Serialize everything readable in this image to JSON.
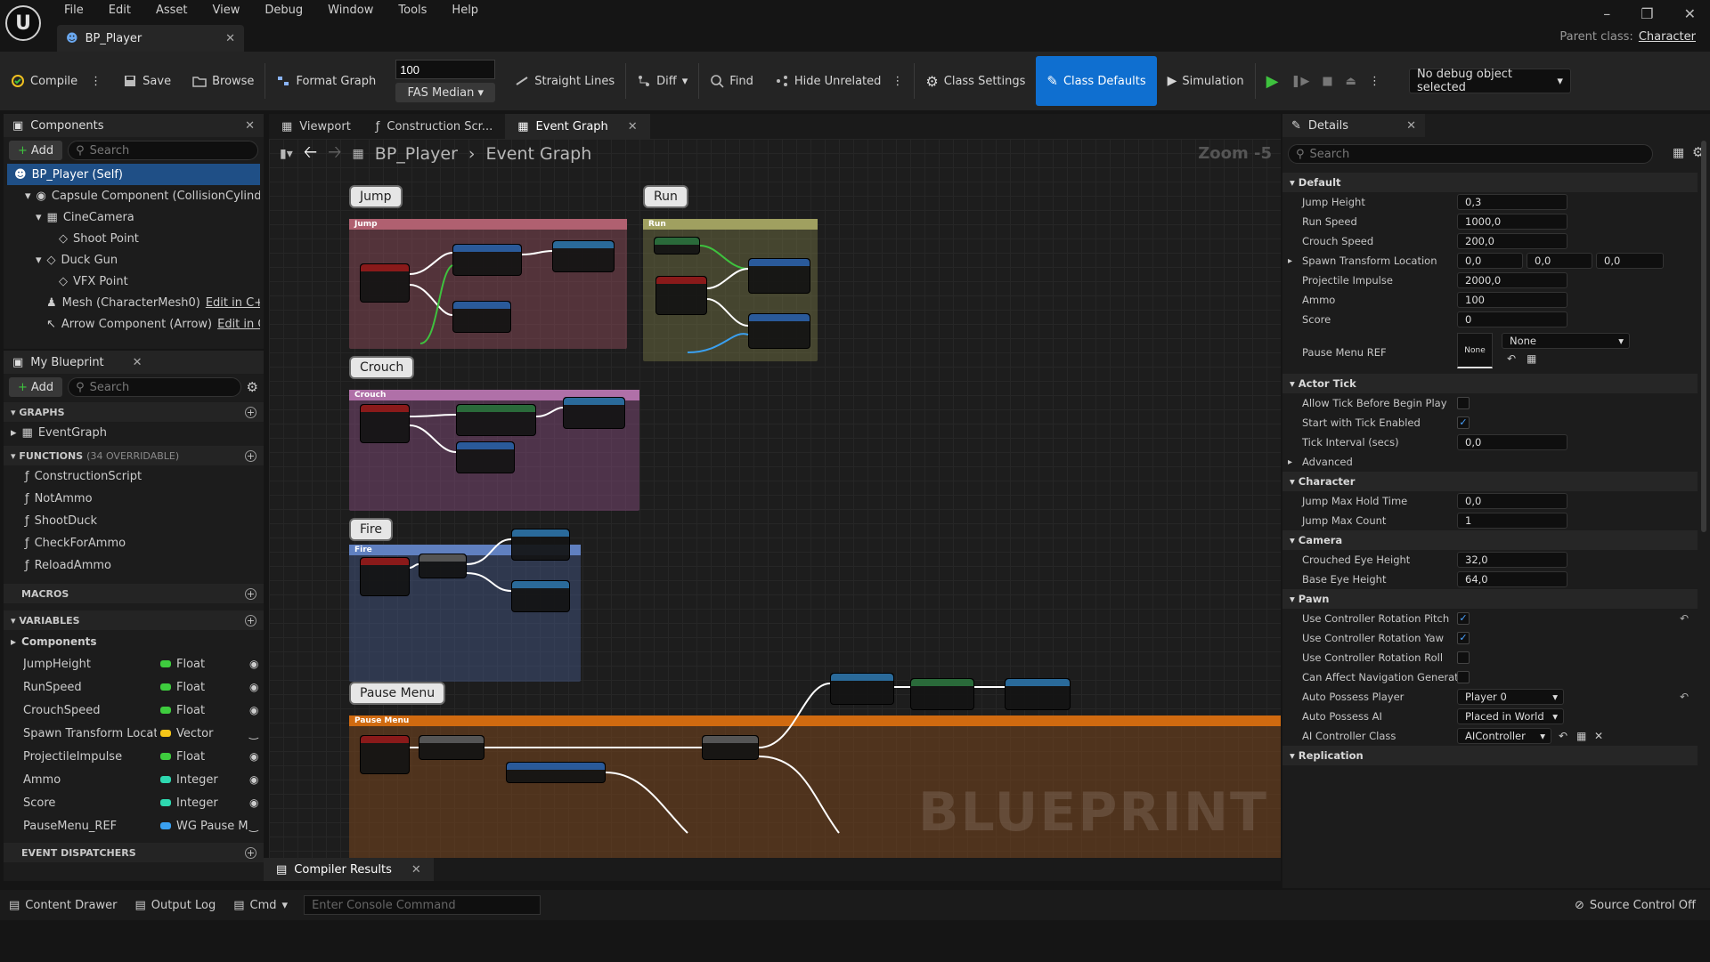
{
  "menu": [
    "File",
    "Edit",
    "Asset",
    "View",
    "Debug",
    "Window",
    "Tools",
    "Help"
  ],
  "asset_tab": {
    "label": "BP_Player"
  },
  "parent_class": {
    "label": "Parent class:",
    "value": "Character"
  },
  "toolbar": {
    "compile": "Compile",
    "save": "Save",
    "browse": "Browse",
    "format_graph": "Format Graph",
    "zoom_value": "100",
    "fas_median": "FAS Median",
    "straight_lines": "Straight Lines",
    "diff": "Diff",
    "find": "Find",
    "hide_unrelated": "Hide Unrelated",
    "class_settings": "Class Settings",
    "class_defaults": "Class Defaults",
    "simulation": "Simulation",
    "debug_object": "No debug object selected"
  },
  "components": {
    "title": "Components",
    "add": "Add",
    "search_placeholder": "Search",
    "items": [
      {
        "label": "BP_Player (Self)"
      },
      {
        "label": "Capsule Component (CollisionCylinde"
      },
      {
        "label": "CineCamera"
      },
      {
        "label": "Shoot Point"
      },
      {
        "label": "Duck Gun"
      },
      {
        "label": "VFX Point"
      },
      {
        "label": "Mesh (CharacterMesh0)",
        "edit": "Edit in C+"
      },
      {
        "label": "Arrow Component (Arrow)",
        "edit": "Edit in C"
      }
    ]
  },
  "my_blueprint": {
    "title": "My Blueprint",
    "add": "Add",
    "search_placeholder": "Search",
    "graphs_label": "GRAPHS",
    "graphs": [
      "EventGraph"
    ],
    "functions_label": "FUNCTIONS",
    "functions_sub": "(34 OVERRIDABLE)",
    "functions": [
      "ConstructionScript",
      "NotAmmo",
      "ShootDuck",
      "CheckForAmmo",
      "ReloadAmmo"
    ],
    "macros_label": "MACROS",
    "variables_label": "VARIABLES",
    "components_group": "Components",
    "variables": [
      {
        "name": "JumpHeight",
        "type": "Float",
        "color": "#3ecc3e"
      },
      {
        "name": "RunSpeed",
        "type": "Float",
        "color": "#3ecc3e"
      },
      {
        "name": "CrouchSpeed",
        "type": "Float",
        "color": "#3ecc3e"
      },
      {
        "name": "Spawn Transform Locati",
        "type": "Vector",
        "color": "#f5c518"
      },
      {
        "name": "ProjectileImpulse",
        "type": "Float",
        "color": "#3ecc3e"
      },
      {
        "name": "Ammo",
        "type": "Integer",
        "color": "#2ed8b0"
      },
      {
        "name": "Score",
        "type": "Integer",
        "color": "#2ed8b0"
      },
      {
        "name": "PauseMenu_REF",
        "type": "WG Pause M",
        "color": "#3aa0f0"
      }
    ],
    "event_dispatchers_label": "EVENT DISPATCHERS"
  },
  "graph_tabs": [
    "Viewport",
    "Construction Scr...",
    "Event Graph"
  ],
  "breadcrumb": {
    "root": "BP_Player",
    "current": "Event Graph",
    "zoom": "Zoom -5"
  },
  "graph": {
    "bubbles": [
      "Jump",
      "Run",
      "Crouch",
      "Fire",
      "Pause Menu"
    ],
    "comments": [
      "Jump",
      "Run",
      "Crouch",
      "Fire",
      "Pause Menu"
    ],
    "watermark": "BLUEPRINT"
  },
  "compiler_results": "Compiler Results",
  "details": {
    "title": "Details",
    "search_placeholder": "Search",
    "sections": {
      "default": "Default",
      "actor_tick": "Actor Tick",
      "advanced": "Advanced",
      "character": "Character",
      "camera": "Camera",
      "pawn": "Pawn",
      "replication": "Replication"
    },
    "fields": {
      "jump_height": {
        "label": "Jump Height",
        "value": "0,3"
      },
      "run_speed": {
        "label": "Run Speed",
        "value": "1000,0"
      },
      "crouch_speed": {
        "label": "Crouch Speed",
        "value": "200,0"
      },
      "spawn_transform": {
        "label": "Spawn Transform Location",
        "x": "0,0",
        "y": "0,0",
        "z": "0,0"
      },
      "projectile_impulse": {
        "label": "Projectile Impulse",
        "value": "2000,0"
      },
      "ammo": {
        "label": "Ammo",
        "value": "100"
      },
      "score": {
        "label": "Score",
        "value": "0"
      },
      "pause_menu_ref": {
        "label": "Pause Menu REF",
        "thumb": "None",
        "value": "None"
      },
      "allow_tick": {
        "label": "Allow Tick Before Begin Play"
      },
      "start_tick": {
        "label": "Start with Tick Enabled"
      },
      "tick_interval": {
        "label": "Tick Interval (secs)",
        "value": "0,0"
      },
      "jump_max_hold": {
        "label": "Jump Max Hold Time",
        "value": "0,0"
      },
      "jump_max_count": {
        "label": "Jump Max Count",
        "value": "1"
      },
      "crouched_eye": {
        "label": "Crouched Eye Height",
        "value": "32,0"
      },
      "base_eye": {
        "label": "Base Eye Height",
        "value": "64,0"
      },
      "rot_pitch": {
        "label": "Use Controller Rotation Pitch"
      },
      "rot_yaw": {
        "label": "Use Controller Rotation Yaw"
      },
      "rot_roll": {
        "label": "Use Controller Rotation Roll"
      },
      "can_affect_nav": {
        "label": "Can Affect Navigation Generat..."
      },
      "auto_possess_player": {
        "label": "Auto Possess Player",
        "value": "Player 0"
      },
      "auto_possess_ai": {
        "label": "Auto Possess AI",
        "value": "Placed in World"
      },
      "ai_controller": {
        "label": "AI Controller Class",
        "value": "AIController"
      }
    }
  },
  "statusbar": {
    "content_drawer": "Content Drawer",
    "output_log": "Output Log",
    "cmd": "Cmd",
    "console_placeholder": "Enter Console Command",
    "source_control": "Source Control Off"
  }
}
